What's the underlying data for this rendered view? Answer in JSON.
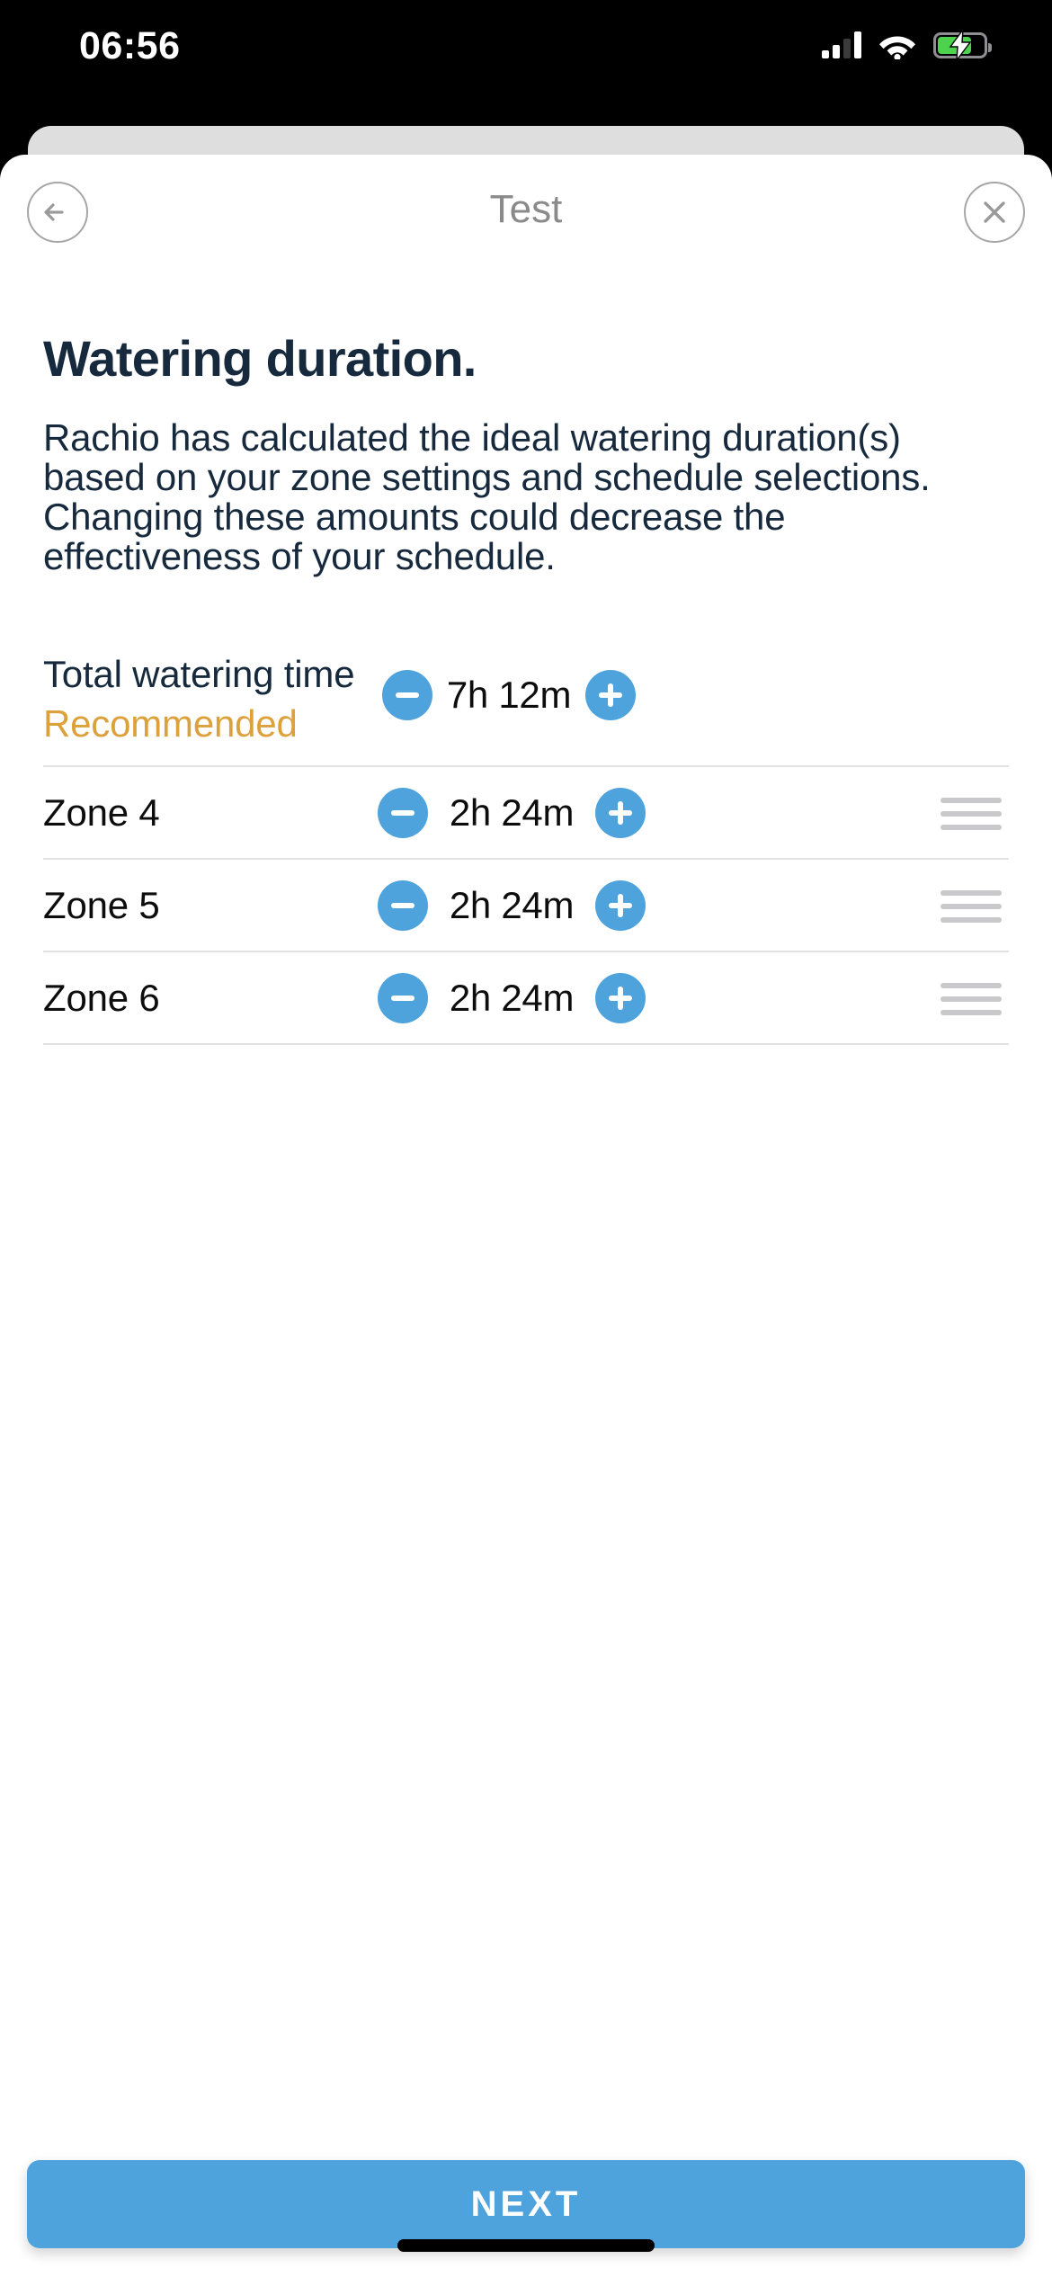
{
  "status_bar": {
    "time": "06:56",
    "icons": [
      "cellular-signal-icon",
      "wifi-icon",
      "battery-charging-icon"
    ],
    "battery_level_percent": 74,
    "battery_charging": true,
    "battery_color": "#4cd24c"
  },
  "nav": {
    "title": "Test",
    "back_icon": "arrow-left-icon",
    "close_icon": "close-icon"
  },
  "page": {
    "heading": "Watering duration.",
    "description": "Rachio has calculated the ideal watering duration(s) based on your zone settings and schedule selections. Changing these amounts could decrease the effectiveness of your schedule."
  },
  "duration_list": {
    "total": {
      "label": "Total watering time",
      "sublabel": "Recommended",
      "value": "7h 12m",
      "decrement_label": "−",
      "increment_label": "+"
    },
    "zones": [
      {
        "label": "Zone 4",
        "value": "2h 24m"
      },
      {
        "label": "Zone 5",
        "value": "2h 24m"
      },
      {
        "label": "Zone 6",
        "value": "2h 24m"
      }
    ]
  },
  "footer": {
    "next_label": "NEXT"
  },
  "colors": {
    "accent_blue": "#4fa3dd",
    "recommended_amber": "#dda13c",
    "heading_navy": "#16293d",
    "divider_grey": "#e2e2e2",
    "drag_handle_grey": "#c9c9cc",
    "nav_grey": "#8a8a8a"
  }
}
